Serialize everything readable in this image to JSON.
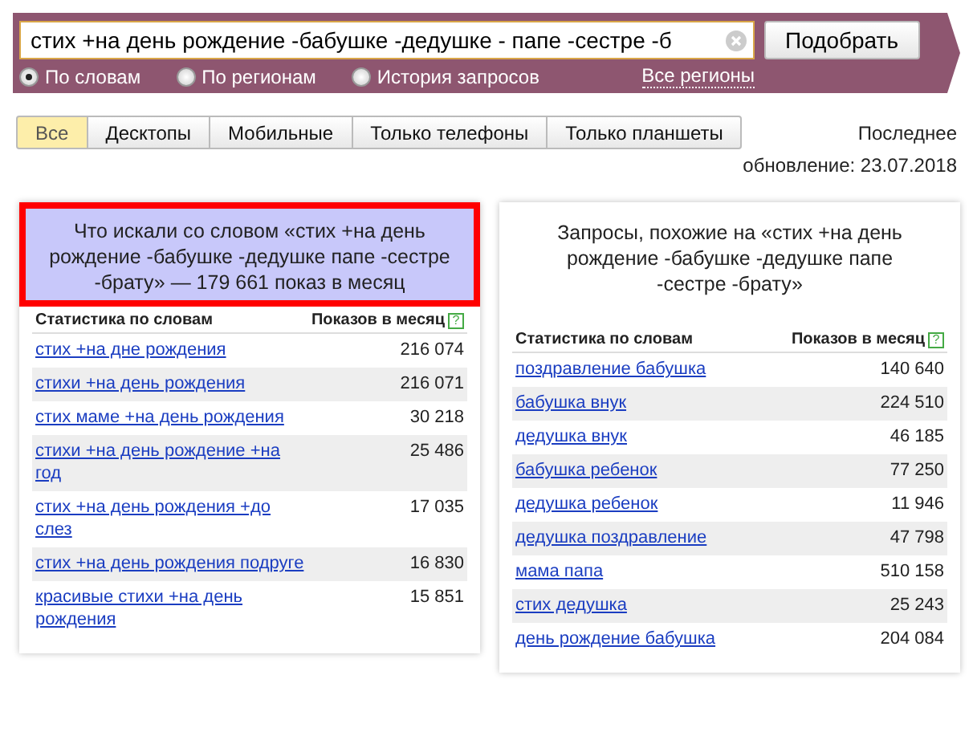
{
  "search": {
    "value": "стих +на день рождение -бабушке -дедушке - папе -сестре -б",
    "button": "Подобрать",
    "modes": [
      {
        "label": "По словам",
        "selected": true
      },
      {
        "label": "По регионам",
        "selected": false
      },
      {
        "label": "История запросов",
        "selected": false
      }
    ],
    "regions_link": "Все регионы"
  },
  "tabs": [
    {
      "label": "Все",
      "selected": true
    },
    {
      "label": "Десктопы",
      "selected": false
    },
    {
      "label": "Мобильные",
      "selected": false
    },
    {
      "label": "Только телефоны",
      "selected": false
    },
    {
      "label": "Только планшеты",
      "selected": false
    }
  ],
  "update": {
    "line_1": "Последнее",
    "line_2": "обновление: 23.07.2018"
  },
  "panels": [
    {
      "title": "Что искали со словом «стих +на день рождение -бабушке -дедушке папе -сестре -брату» — 179 661 показ в месяц",
      "highlighted": true,
      "columns": [
        "Статистика по словам",
        "Показов в месяц"
      ],
      "help": "?",
      "rows": [
        {
          "phrase": "стих +на дне рождения",
          "count": "216 074"
        },
        {
          "phrase": "стихи +на день рождения",
          "count": "216 071"
        },
        {
          "phrase": "стих маме +на день рождения",
          "count": "30 218"
        },
        {
          "phrase": "стихи +на день рождение +на год",
          "count": "25 486"
        },
        {
          "phrase": "стих +на день рождения +до слез",
          "count": "17 035"
        },
        {
          "phrase": "стих +на день рождения подруге",
          "count": "16 830"
        },
        {
          "phrase": "красивые стихи +на день рождения",
          "count": "15 851"
        }
      ]
    },
    {
      "title": "Запросы, похожие на «стих +на день рождение -бабушке -дедушке папе -сестре -брату»",
      "highlighted": false,
      "columns": [
        "Статистика по словам",
        "Показов в месяц"
      ],
      "help": "?",
      "rows": [
        {
          "phrase": "поздравление бабушка",
          "count": "140 640"
        },
        {
          "phrase": "бабушка внук",
          "count": "224 510"
        },
        {
          "phrase": "дедушка внук",
          "count": "46 185"
        },
        {
          "phrase": "бабушка ребенок",
          "count": "77 250"
        },
        {
          "phrase": "дедушка ребенок",
          "count": "11 946"
        },
        {
          "phrase": "дедушка поздравление",
          "count": "47 798"
        },
        {
          "phrase": "мама папа",
          "count": "510 158"
        },
        {
          "phrase": "стих дедушка",
          "count": "25 243"
        },
        {
          "phrase": "день рождение бабушка",
          "count": "204 084"
        }
      ]
    }
  ]
}
